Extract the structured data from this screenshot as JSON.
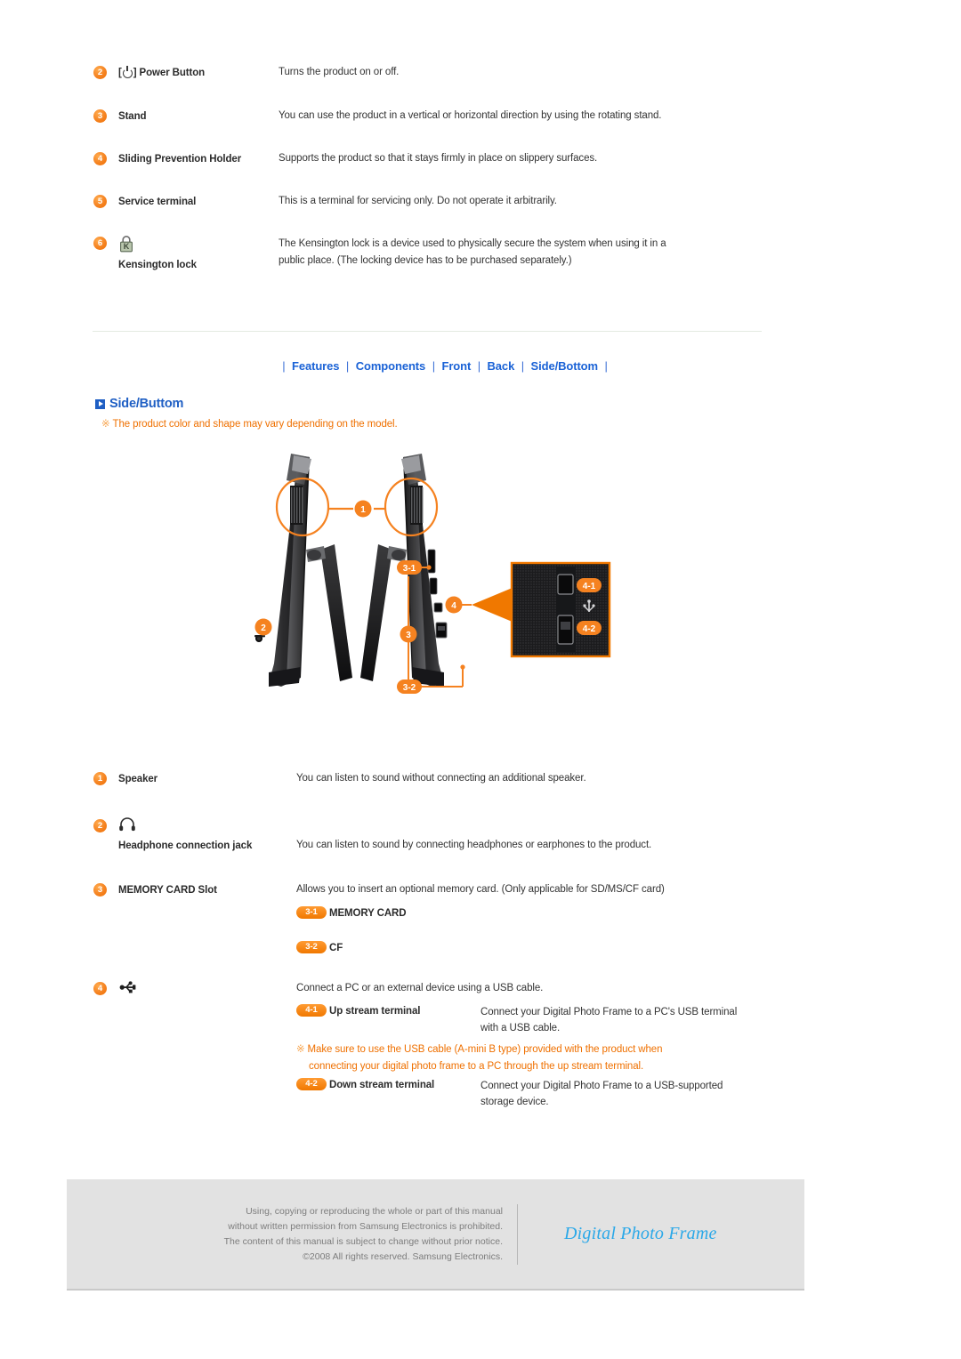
{
  "top_spec_rows": [
    {
      "num": "2",
      "icon": "power-icon",
      "label": "] Power Button",
      "label_prefix": "[",
      "desc": "Turns the product on or off."
    },
    {
      "num": "3",
      "icon": "",
      "label": "Stand",
      "desc": "You can use the product in a vertical or horizontal direction by using the rotating stand."
    },
    {
      "num": "4",
      "icon": "",
      "label": "Sliding Prevention",
      "label2": "Holder",
      "desc": "Supports the product so that it stays firmly in place on slippery surfaces."
    },
    {
      "num": "5",
      "icon": "",
      "label": "Service terminal",
      "desc": "This is a terminal for servicing only. Do not operate it arbitrarily."
    },
    {
      "num": "6",
      "icon": "kensington-lock-icon",
      "label": "Kensington lock",
      "desc_line1": "The Kensington lock is a device used to physically secure the system when using it in a",
      "desc_line2": "public place. (The locking device has to be purchased separately.)"
    }
  ],
  "nav": {
    "items": [
      {
        "label": "Features"
      },
      {
        "label": "Components"
      },
      {
        "label": "Front"
      },
      {
        "label": "Back"
      },
      {
        "label": "Side/Bottom"
      }
    ],
    "separator": "|"
  },
  "section": {
    "title": "Side/Buttom",
    "note_mark": "※",
    "note": "The product color and shape may vary depending on the model."
  },
  "diagram": {
    "callouts": [
      {
        "id": "1",
        "meaning": "speaker"
      },
      {
        "id": "2",
        "meaning": "headphone-jack"
      },
      {
        "id": "3",
        "meaning": "memory-card-slot"
      },
      {
        "id": "3-1",
        "meaning": "memory-card"
      },
      {
        "id": "3-2",
        "meaning": "cf-card"
      },
      {
        "id": "4",
        "meaning": "usb-terminals"
      },
      {
        "id": "4-1",
        "meaning": "up-stream-terminal"
      },
      {
        "id": "4-2",
        "meaning": "down-stream-terminal"
      }
    ],
    "alt": "Side and bottom views of the digital photo frame with numbered callouts"
  },
  "bottom_spec_rows": [
    {
      "num": "1",
      "label": "Speaker",
      "desc": "You can listen to sound without connecting an additional speaker."
    },
    {
      "num": "2",
      "icon": "headphone-icon",
      "label": "Headphone connection",
      "label2": "jack",
      "desc": "You can listen to sound by connecting headphones or earphones to the product."
    },
    {
      "num": "3",
      "label": "MEMORY CARD Slot",
      "desc": "Allows you to insert an optional memory card. (Only applicable for SD/MS/CF card)",
      "subitems": [
        {
          "badge": "3-1",
          "name": "MEMORY CARD"
        },
        {
          "badge": "3-2",
          "name": "CF"
        }
      ]
    },
    {
      "num": "4",
      "icon": "usb-icon",
      "label": "",
      "desc": "Connect a PC or an external device using a USB cable.",
      "subitems": [
        {
          "badge": "4-1",
          "name": "Up stream terminal",
          "desc_line1": "Connect your Digital Photo Frame to a PC's USB terminal",
          "desc_line2": "with a USB cable."
        },
        {
          "badge": "4-2",
          "name": "Down stream terminal",
          "desc_line1": "Connect your Digital Photo Frame to a USB-supported",
          "desc_line2": "storage device."
        }
      ],
      "warning_mark": "※",
      "warning_line1": "Make sure to use the USB cable (A-mini B type) provided with the product when",
      "warning_line2": "connecting your digital photo frame to a PC through the up stream terminal."
    }
  ],
  "footer": {
    "line1": "Using, copying or reproducing the whole or part of this manual",
    "line2": "without written permission from Samsung Electronics  is prohibited.",
    "line3": "The content of this manual is subject to change without prior notice.",
    "line4": "©2008 All rights reserved. Samsung Electronics.",
    "brand": "Digital Photo Frame"
  },
  "colors": {
    "accent_orange": "#F07800",
    "link_blue": "#1A62D6",
    "heading_blue": "#1F5FC4",
    "brand_blue": "#2AA8E8",
    "footer_bg": "#E2E2E2"
  }
}
